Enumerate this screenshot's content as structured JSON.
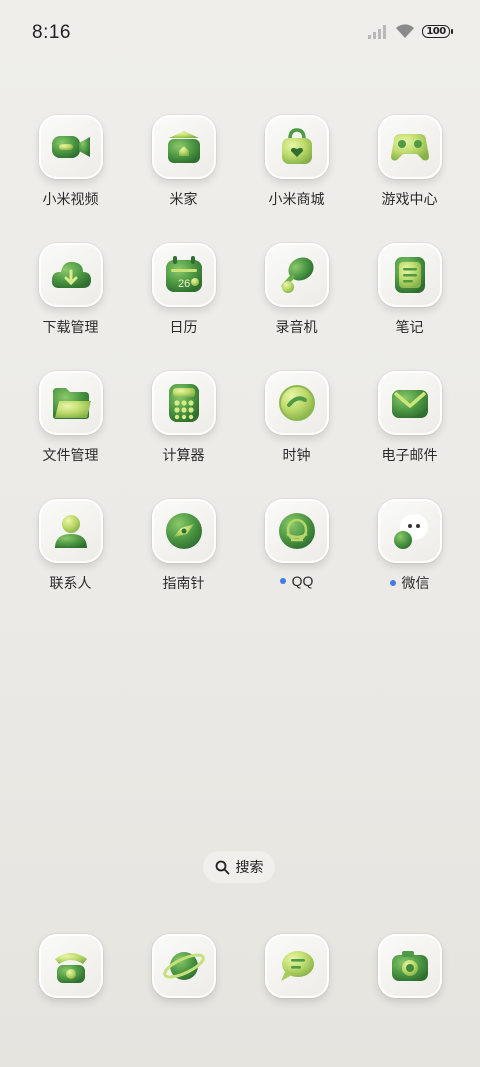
{
  "status_bar": {
    "time": "8:16",
    "battery": "100",
    "icons": [
      "signal-icon",
      "wifi-icon",
      "battery-icon"
    ]
  },
  "apps": [
    {
      "label": "小米视频",
      "icon": "video-camera-icon"
    },
    {
      "label": "米家",
      "icon": "smart-home-icon"
    },
    {
      "label": "小米商城",
      "icon": "shopping-bag-icon"
    },
    {
      "label": "游戏中心",
      "icon": "gamepad-icon"
    },
    {
      "label": "下载管理",
      "icon": "download-cloud-icon"
    },
    {
      "label": "日历",
      "icon": "calendar-icon",
      "date": "26"
    },
    {
      "label": "录音机",
      "icon": "microphone-icon"
    },
    {
      "label": "笔记",
      "icon": "notepad-icon"
    },
    {
      "label": "文件管理",
      "icon": "folder-icon"
    },
    {
      "label": "计算器",
      "icon": "calculator-icon"
    },
    {
      "label": "时钟",
      "icon": "clock-icon"
    },
    {
      "label": "电子邮件",
      "icon": "envelope-icon"
    },
    {
      "label": "联系人",
      "icon": "contact-person-icon"
    },
    {
      "label": "指南针",
      "icon": "compass-icon"
    },
    {
      "label": "QQ",
      "icon": "qq-icon",
      "new_badge": true
    },
    {
      "label": "微信",
      "icon": "wechat-icon",
      "new_badge": true
    }
  ],
  "search": {
    "label": "搜索",
    "icon": "search-icon"
  },
  "dock": [
    {
      "icon": "phone-icon"
    },
    {
      "icon": "browser-planet-icon"
    },
    {
      "icon": "messages-icon"
    },
    {
      "icon": "camera-icon"
    }
  ],
  "colors": {
    "dark_green": "#3f8a3c",
    "mid_green": "#6cad4d",
    "light_green": "#b6d66a",
    "badge_blue": "#3f7be8"
  }
}
